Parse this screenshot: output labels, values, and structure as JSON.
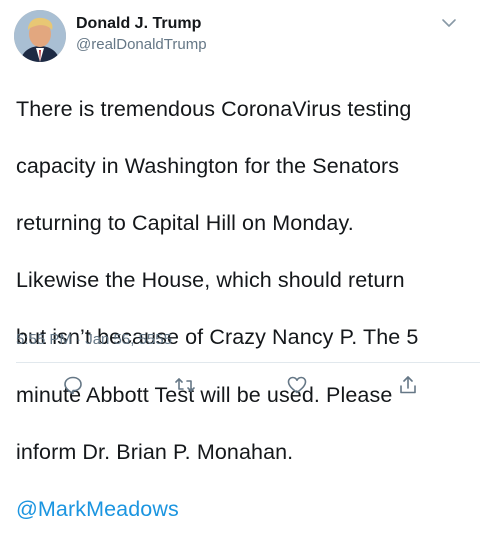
{
  "tweet": {
    "author": {
      "display_name": "Donald J. Trump",
      "handle": "@realDonaldTrump"
    },
    "text_lines": [
      "There is tremendous CoronaVirus testing",
      "capacity in Washington for the Senators",
      "returning to Capital Hill on Monday.",
      "Likewise the House, which should return",
      "but isn’t because of Crazy Nancy P. The 5",
      "minute Abbott Test will be used. Please",
      "inform Dr. Brian P. Monahan."
    ],
    "mention": "@MarkMeadows",
    "timestamp": "5:55 PM · Jan 55, 5555"
  },
  "icons": {
    "more": "chevron-down-icon",
    "reply": "reply-icon",
    "retweet": "retweet-icon",
    "like": "heart-icon",
    "share": "share-icon"
  },
  "colors": {
    "text": "#14171a",
    "secondary": "#657786",
    "link": "#1b95e0",
    "divider": "#e1e8ed"
  }
}
